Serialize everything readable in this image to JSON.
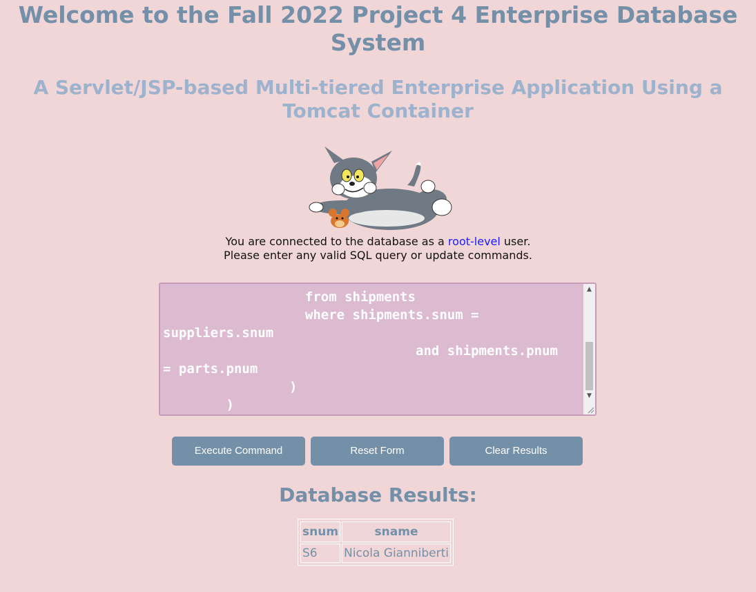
{
  "header": {
    "title": "Welcome to the Fall 2022 Project 4 Enterprise Database System",
    "subtitle": "A Servlet/JSP-based Multi-tiered Enterprise Application Using a Tomcat Container"
  },
  "info": {
    "line1_prefix": "You are connected to the database as a ",
    "line1_highlight": "root-level",
    "line1_suffix": " user.",
    "line2": "Please enter any valid SQL query or update commands."
  },
  "query_box": {
    "text": "                  from shipments\n                  where shipments.snum =\nsuppliers.snum\n                                and shipments.pnum\n= parts.pnum\n                )\n        )"
  },
  "buttons": {
    "execute": "Execute Command",
    "reset": "Reset Form",
    "clear": "Clear Results"
  },
  "results": {
    "title": "Database Results:",
    "columns": [
      "snum",
      "sname"
    ],
    "rows": [
      [
        "S6",
        "Nicola Gianniberti"
      ]
    ]
  },
  "colors": {
    "background": "#f1d6d8",
    "title": "#7390a8",
    "subtitle": "#9db2cd",
    "button": "#7390a8",
    "textarea": "#dcbad0",
    "highlight": "#1a1aff"
  },
  "icons": {
    "mascot": "cartoon-cat-and-mouse-image"
  }
}
